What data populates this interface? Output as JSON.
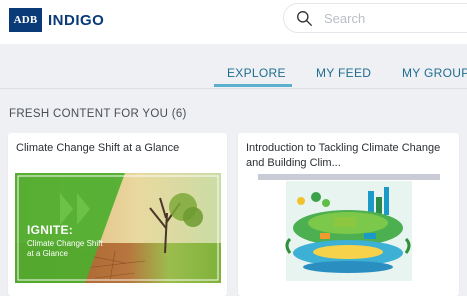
{
  "header": {
    "logo_box": "ADB",
    "logo_text": "INDIGO",
    "search_placeholder": "Search"
  },
  "tabs": [
    {
      "label": "EXPLORE",
      "active": true
    },
    {
      "label": "MY FEED",
      "active": false
    },
    {
      "label": "MY GROUP",
      "active": false
    }
  ],
  "section": {
    "title": "FRESH CONTENT FOR YOU (6)"
  },
  "cards": [
    {
      "title": "Climate Change Shift at a Glance",
      "thumb": {
        "headline": "IGNITE:",
        "subtitle": "Climate Change Shift at a Glance"
      }
    },
    {
      "title": "Introduction to Tackling Climate Change and Building Clim..."
    }
  ],
  "colors": {
    "brand": "#0a3a78",
    "tab_text": "#1f6d8f",
    "tab_active_underline": "#5bb0cf",
    "page_bg": "#eef0f3"
  },
  "icons": {
    "search": "search-icon"
  }
}
